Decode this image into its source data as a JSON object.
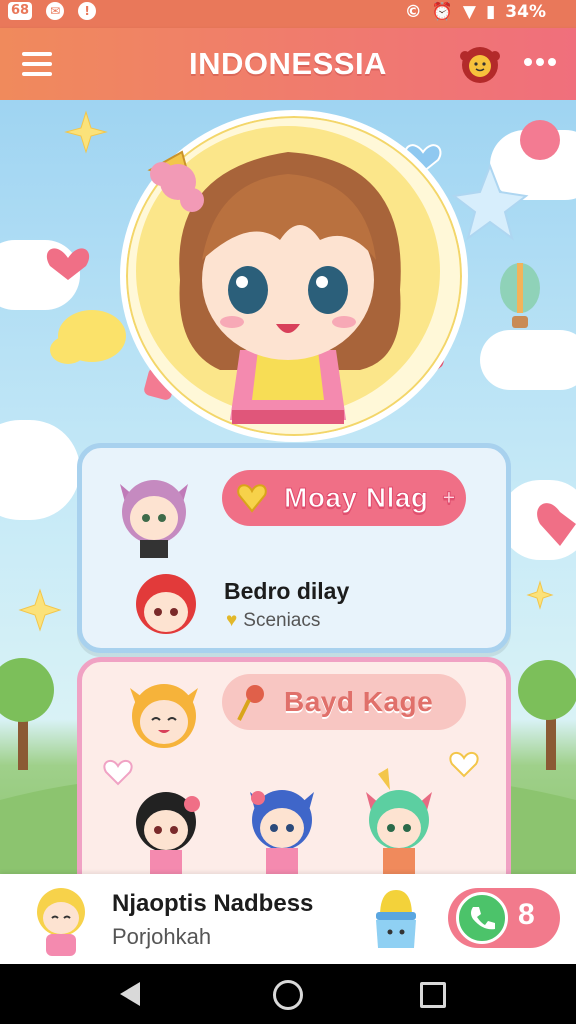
{
  "status_bar": {
    "left_badge": "68",
    "battery": "34%"
  },
  "app_bar": {
    "title": "INDONESSIA"
  },
  "card1": {
    "pill_label": "Moay Nlag",
    "row_name": "Bedro dilay",
    "row_sub": "Sceniacs"
  },
  "card2": {
    "pill_label": "Bayd Kage"
  },
  "bottom_bar": {
    "name": "Njaoptis Nadbess",
    "sub": "Porjohkah",
    "call_count": "8"
  },
  "colors": {
    "app_bar_start": "#f08a5c",
    "app_bar_end": "#f06f7c",
    "pill_pink": "#f06f86",
    "call_green": "#4cc36a"
  }
}
